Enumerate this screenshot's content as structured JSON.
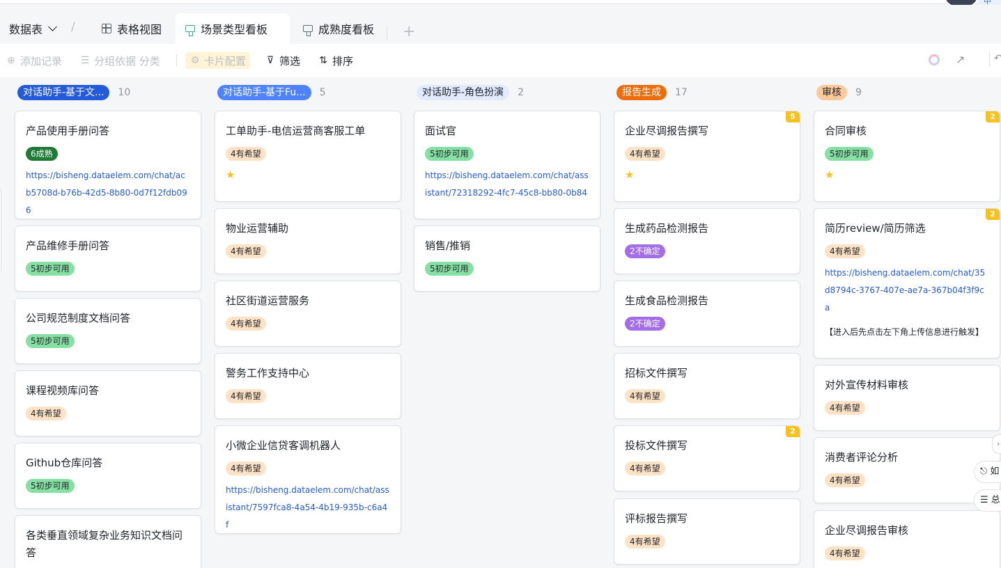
{
  "avatar_chip": "中",
  "nav": {
    "datatable_label": "数据表",
    "tabs": [
      {
        "label": "表格视图"
      },
      {
        "label": "场景类型看板"
      },
      {
        "label": "成熟度看板"
      }
    ],
    "add_tab": "+"
  },
  "toolbar": {
    "add_record": "添加记录",
    "group_by": "分组依据 分类",
    "card_config": "卡片配置",
    "filter": "筛选",
    "sort": "排序"
  },
  "columns": [
    {
      "name": "对话助手-基于文...",
      "count": "10",
      "color": "#245bdb",
      "text_color": "#ffffff",
      "cards": [
        {
          "title": "产品使用手册问答",
          "tag": "6成熟",
          "tag_type": "mature",
          "link": "https://bisheng.dataelem.com/chat/acb5708d-b76b-42d5-8b80-0d7f12fdb096"
        },
        {
          "title": "产品维修手册问答",
          "tag": "5初步可用",
          "tag_type": "usable"
        },
        {
          "title": "公司规范制度文档问答",
          "tag": "5初步可用",
          "tag_type": "usable"
        },
        {
          "title": "课程视频库问答",
          "tag": "4有希望",
          "tag_type": "hope"
        },
        {
          "title": "Github仓库问答",
          "tag": "5初步可用",
          "tag_type": "usable"
        },
        {
          "title": "各类垂直领域复杂业务知识文档问答"
        }
      ]
    },
    {
      "name": "对话助手-基于Fu...",
      "count": "5",
      "color": "#4e83fd",
      "text_color": "#ffffff",
      "cards": [
        {
          "title": "工单助手-电信运营商客服工单",
          "tag": "4有希望",
          "tag_type": "hope",
          "star": "★"
        },
        {
          "title": "物业运营辅助",
          "tag": "4有希望",
          "tag_type": "hope"
        },
        {
          "title": "社区街道运营服务",
          "tag": "4有希望",
          "tag_type": "hope"
        },
        {
          "title": "警务工作支持中心",
          "tag": "4有希望",
          "tag_type": "hope"
        },
        {
          "title": "小微企业信贷客调机器人",
          "tag": "4有希望",
          "tag_type": "hope",
          "link": "https://bisheng.dataelem.com/chat/assistant/7597fca8-4a54-4b19-935b-c6a4f"
        }
      ]
    },
    {
      "name": "对话助手-角色扮演",
      "count": "2",
      "color": "#e1eaff",
      "text_color": "#1f2329",
      "cards": [
        {
          "title": "面试官",
          "tag": "5初步可用",
          "tag_type": "usable",
          "link": "https://bisheng.dataelem.com/chat/assistant/72318292-4fc7-45c8-bb80-0b84"
        },
        {
          "title": "销售/推销",
          "tag": "5初步可用",
          "tag_type": "usable"
        }
      ]
    },
    {
      "name": "报告生成",
      "count": "17",
      "color": "#ed6d0c",
      "text_color": "#ffffff",
      "cards": [
        {
          "title": "企业尽调报告撰写",
          "tag": "4有希望",
          "tag_type": "hope",
          "star": "★",
          "badge": "5"
        },
        {
          "title": "生成药品检测报告",
          "tag": "2不确定",
          "tag_type": "unsure"
        },
        {
          "title": "生成食品检测报告",
          "tag": "2不确定",
          "tag_type": "unsure"
        },
        {
          "title": "招标文件撰写",
          "tag": "4有希望",
          "tag_type": "hope"
        },
        {
          "title": "投标文件撰写",
          "tag": "4有希望",
          "tag_type": "hope",
          "badge": "2"
        },
        {
          "title": "评标报告撰写",
          "tag": "4有希望",
          "tag_type": "hope"
        }
      ]
    },
    {
      "name": "审核",
      "count": "9",
      "color": "#fdc89a",
      "text_color": "#1f2329",
      "cards": [
        {
          "title": "合同审核",
          "tag": "5初步可用",
          "tag_type": "usable",
          "star": "★",
          "badge": "2"
        },
        {
          "title": "简历review/简历筛选",
          "tag": "4有希望",
          "tag_type": "hope",
          "link": "https://bisheng.dataelem.com/chat/35d8794c-3767-407e-ae7a-367b04f3f9ca",
          "note": "【进入后先点击左下角上传信息进行触发】",
          "badge": "2"
        },
        {
          "title": "对外宣传材料审核",
          "tag": "4有希望",
          "tag_type": "hope"
        },
        {
          "title": "消费者评论分析",
          "tag": "4有希望",
          "tag_type": "hope"
        },
        {
          "title": "企业尽调报告审核",
          "tag": "4有希望",
          "tag_type": "hope"
        }
      ]
    }
  ],
  "floating": {
    "btn1": "⎋ 如",
    "btn2": "☰ 总"
  }
}
